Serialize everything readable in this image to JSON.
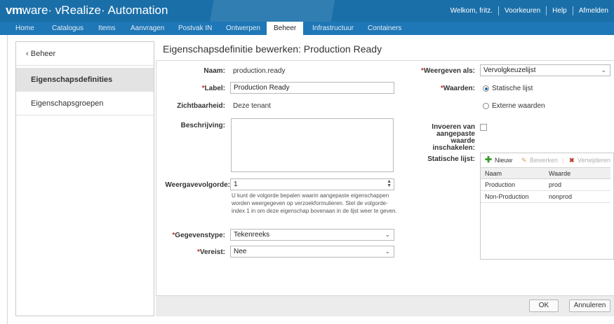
{
  "header": {
    "brand_vm": "vm",
    "brand_rest": "ware· vRealize· Automation",
    "welcome": "Welkom, fritz.",
    "preferences": "Voorkeuren",
    "help": "Help",
    "logout": "Afmelden"
  },
  "nav": {
    "tabs": [
      {
        "label": "Home"
      },
      {
        "label": "Catalogus"
      },
      {
        "label": "Items"
      },
      {
        "label": "Aanvragen"
      },
      {
        "label": "Postvak IN"
      },
      {
        "label": "Ontwerpen"
      },
      {
        "label": "Beheer",
        "active": true
      },
      {
        "label": "Infrastructuur"
      },
      {
        "label": "Containers"
      }
    ]
  },
  "sidebar": {
    "back_label": "Beheer",
    "items": [
      {
        "label": "Eigenschapsdefinities",
        "selected": true
      },
      {
        "label": "Eigenschapsgroepen",
        "selected": false
      }
    ]
  },
  "page": {
    "title": "Eigenschapsdefinitie bewerken: Production Ready"
  },
  "form": {
    "name_label": "Naam:",
    "name_value": "production.ready",
    "label_label": "Label:",
    "label_value": "Production Ready",
    "visibility_label": "Zichtbaarheid:",
    "visibility_value": "Deze tenant",
    "description_label": "Beschrijving:",
    "description_value": "",
    "order_label": "Weergavevolgorde:",
    "order_value": "1",
    "order_help": "U kunt de volgorde bepalen waarin aangepaste eigenschappen worden weergegeven op verzoekformulieren. Stel de volgorde-index 1 in om deze eigenschap bovenaan in de lijst weer te geven.",
    "datatype_label": "Gegevenstype:",
    "datatype_value": "Tekenreeks",
    "required_label": "Vereist:",
    "required_value": "Nee",
    "display_as_label": "Weergeven als:",
    "display_as_value": "Vervolgkeuzelijst",
    "values_label": "Waarden:",
    "static_list_option": "Statische lijst",
    "external_values_option": "Externe waarden",
    "custom_value_label": "Invoeren van aangepaste waarde inschakelen:",
    "static_list_label": "Statische lijst:"
  },
  "grid": {
    "new_label": "Nieuw",
    "edit_label": "Bewerken",
    "delete_label": "Verwijderen",
    "columns": [
      "Naam",
      "Waarde"
    ],
    "rows": [
      {
        "name": "Production",
        "value": "prod"
      },
      {
        "name": "Non-Production",
        "value": "nonprod"
      }
    ]
  },
  "footer": {
    "ok_label": "OK",
    "cancel_label": "Annuleren"
  },
  "colors": {
    "header_blue": "#1a6fa9",
    "nav_blue": "#1e77b6",
    "required_red": "#c92c2c",
    "add_green": "#3a9a2f",
    "delete_red": "#c0392b"
  }
}
